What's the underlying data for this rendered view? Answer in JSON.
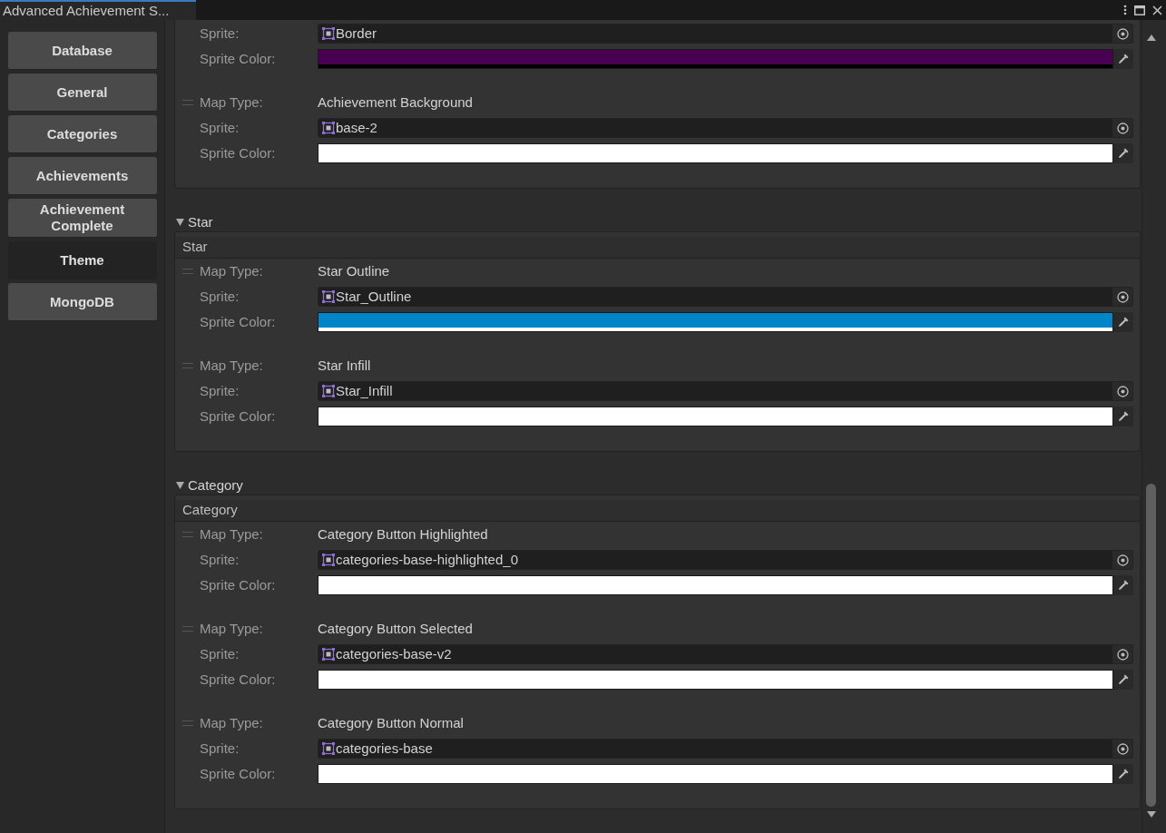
{
  "window": {
    "title": "Advanced Achievement S..."
  },
  "sidebar": {
    "items": [
      {
        "label": "Database",
        "selected": false
      },
      {
        "label": "General",
        "selected": false
      },
      {
        "label": "Categories",
        "selected": false
      },
      {
        "label": "Achievements",
        "selected": false
      },
      {
        "label": "Achievement Complete",
        "selected": false
      },
      {
        "label": "Theme",
        "selected": true
      },
      {
        "label": "MongoDB",
        "selected": false
      }
    ]
  },
  "sections": [
    {
      "items": [
        {
          "rows": [
            {
              "kind": "sprite",
              "label": "Sprite:",
              "value": "Border"
            },
            {
              "kind": "color",
              "label": "Sprite Color:",
              "color": "#4a0050",
              "level": 0
            }
          ]
        },
        {
          "rows": [
            {
              "kind": "map_type",
              "label": "Map Type:",
              "value": "Achievement Background"
            },
            {
              "kind": "sprite",
              "label": "Sprite:",
              "value": "base-2"
            },
            {
              "kind": "color",
              "label": "Sprite Color:",
              "color": "#ffffff",
              "level": 1
            }
          ]
        }
      ]
    },
    {
      "title": "Star",
      "expanded": true,
      "header": "Star",
      "items": [
        {
          "rows": [
            {
              "kind": "map_type",
              "label": "Map Type:",
              "value": "Star Outline"
            },
            {
              "kind": "sprite",
              "label": "Sprite:",
              "value": "Star_Outline"
            },
            {
              "kind": "color",
              "label": "Sprite Color:",
              "color": "#0086c8",
              "level": 1
            }
          ]
        },
        {
          "rows": [
            {
              "kind": "map_type",
              "label": "Map Type:",
              "value": "Star Infill"
            },
            {
              "kind": "sprite",
              "label": "Sprite:",
              "value": "Star_Infill"
            },
            {
              "kind": "color",
              "label": "Sprite Color:",
              "color": "#ffffff",
              "level": 1
            }
          ]
        }
      ]
    },
    {
      "title": "Category",
      "expanded": true,
      "header": "Category",
      "items": [
        {
          "rows": [
            {
              "kind": "map_type",
              "label": "Map Type:",
              "value": "Category Button Highlighted"
            },
            {
              "kind": "sprite",
              "label": "Sprite:",
              "value": "categories-base-highlighted_0"
            },
            {
              "kind": "color",
              "label": "Sprite Color:",
              "color": "#ffffff",
              "level": 1
            }
          ]
        },
        {
          "rows": [
            {
              "kind": "map_type",
              "label": "Map Type:",
              "value": "Category Button Selected"
            },
            {
              "kind": "sprite",
              "label": "Sprite:",
              "value": "categories-base-v2"
            },
            {
              "kind": "color",
              "label": "Sprite Color:",
              "color": "#ffffff",
              "level": 1
            }
          ]
        },
        {
          "rows": [
            {
              "kind": "map_type",
              "label": "Map Type:",
              "value": "Category Button Normal"
            },
            {
              "kind": "sprite",
              "label": "Sprite:",
              "value": "categories-base"
            },
            {
              "kind": "color",
              "label": "Sprite Color:",
              "color": "#ffffff",
              "level": 1
            }
          ]
        }
      ]
    }
  ]
}
